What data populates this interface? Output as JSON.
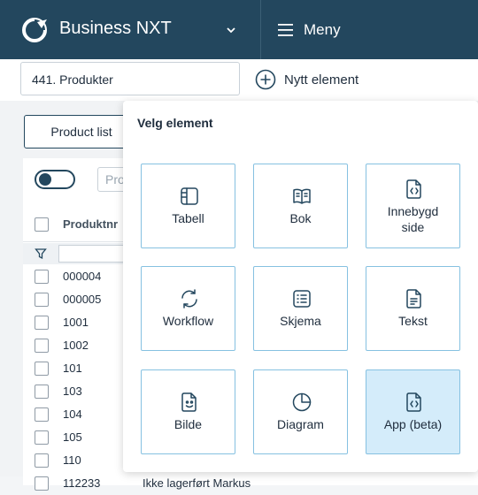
{
  "header": {
    "company": "Business NXT",
    "menu_label": "Meny"
  },
  "subbar": {
    "page_value": "441. Produkter",
    "new_element_label": "Nytt element"
  },
  "view": {
    "tab_label": "Product list",
    "search_placeholder": "Pro",
    "column_header": "Produktnr"
  },
  "rows": [
    {
      "num": "000004",
      "name": ""
    },
    {
      "num": "000005",
      "name": ""
    },
    {
      "num": "1001",
      "name": ""
    },
    {
      "num": "1002",
      "name": ""
    },
    {
      "num": "101",
      "name": ""
    },
    {
      "num": "103",
      "name": ""
    },
    {
      "num": "104",
      "name": ""
    },
    {
      "num": "105",
      "name": ""
    },
    {
      "num": "110",
      "name": ""
    },
    {
      "num": "112233",
      "name": "Ikke lagerført Markus"
    }
  ],
  "popup": {
    "title": "Velg element",
    "tiles": [
      {
        "label": "Tabell",
        "icon": "table-icon"
      },
      {
        "label": "Bok",
        "icon": "book-icon"
      },
      {
        "label": "Innebygd side",
        "icon": "embedded-page-icon"
      },
      {
        "label": "Workflow",
        "icon": "workflow-icon"
      },
      {
        "label": "Skjema",
        "icon": "form-icon"
      },
      {
        "label": "Tekst",
        "icon": "text-icon"
      },
      {
        "label": "Bilde",
        "icon": "image-icon"
      },
      {
        "label": "Diagram",
        "icon": "chart-icon"
      },
      {
        "label": "App (beta)",
        "icon": "app-icon",
        "selected": true
      }
    ]
  },
  "colors": {
    "topbar": "#23475e",
    "tile_border": "#86c1e1",
    "tile_selected": "#d4ecfa"
  }
}
